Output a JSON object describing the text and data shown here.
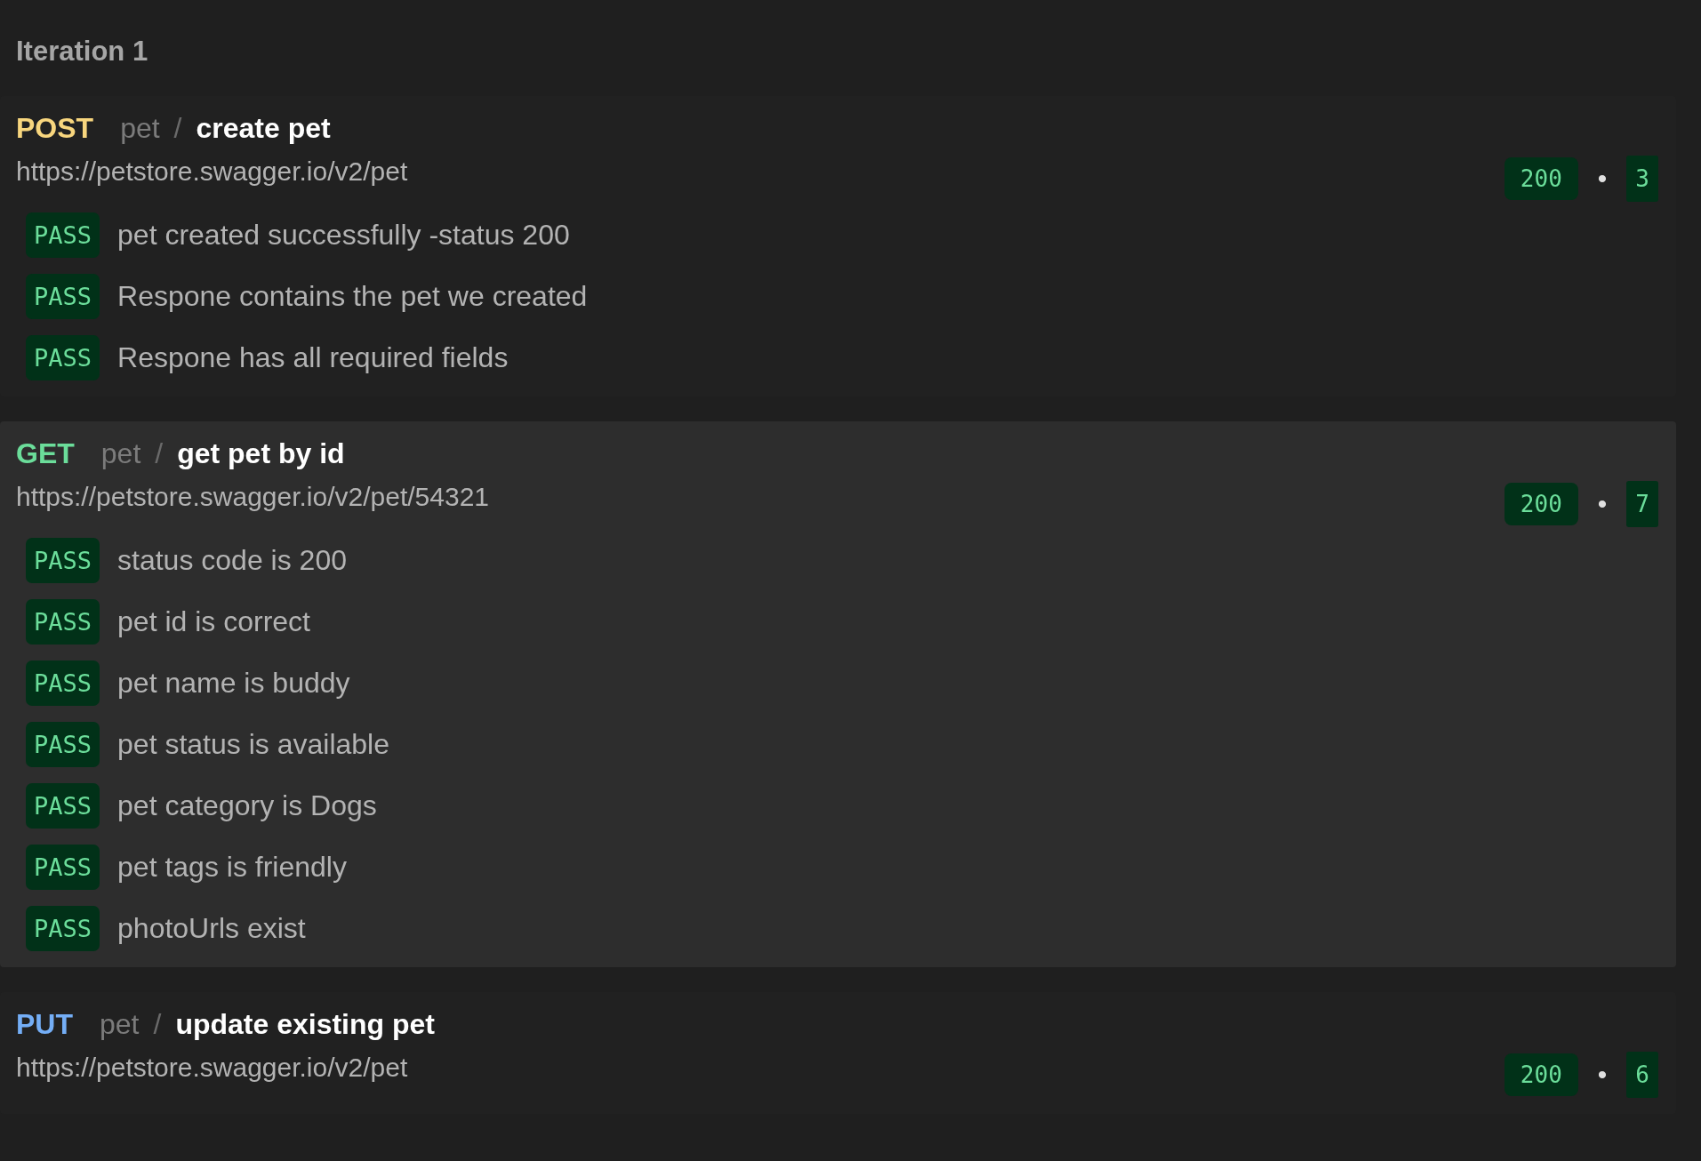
{
  "iteration": {
    "title": "Iteration 1"
  },
  "requests": [
    {
      "method": "POST",
      "color": "#f8d67e",
      "folder": "pet",
      "separator": "/",
      "name": "create pet",
      "url": "https://petstore.swagger.io/v2/pet",
      "status": "200",
      "dot": "•",
      "count": "3",
      "selected": false,
      "tests": [
        {
          "kind": "pass",
          "label": "PASS",
          "name": "pet created successfully -status 200"
        },
        {
          "kind": "pass",
          "label": "PASS",
          "name": "Respone contains the pet we created"
        },
        {
          "kind": "pass",
          "label": "PASS",
          "name": "Respone has all required fields"
        }
      ]
    },
    {
      "method": "GET",
      "color": "#6bdd9a",
      "folder": "pet",
      "separator": "/",
      "name": "get pet by id",
      "url": "https://petstore.swagger.io/v2/pet/54321",
      "status": "200",
      "dot": "•",
      "count": "7",
      "selected": true,
      "tests": [
        {
          "kind": "pass",
          "label": "PASS",
          "name": "status code is 200"
        },
        {
          "kind": "pass",
          "label": "PASS",
          "name": "pet id is correct"
        },
        {
          "kind": "pass",
          "label": "PASS",
          "name": "pet name is buddy"
        },
        {
          "kind": "pass",
          "label": "PASS",
          "name": "pet status is available"
        },
        {
          "kind": "pass",
          "label": "PASS",
          "name": "pet category is Dogs"
        },
        {
          "kind": "pass",
          "label": "PASS",
          "name": "pet tags is friendly"
        },
        {
          "kind": "pass",
          "label": "PASS",
          "name": "photoUrls exist"
        }
      ]
    },
    {
      "method": "PUT",
      "color": "#74aef6",
      "folder": "pet",
      "separator": "/",
      "name": "update existing pet",
      "url": "https://petstore.swagger.io/v2/pet",
      "status": "200",
      "dot": "•",
      "count": "6",
      "selected": false
    }
  ]
}
